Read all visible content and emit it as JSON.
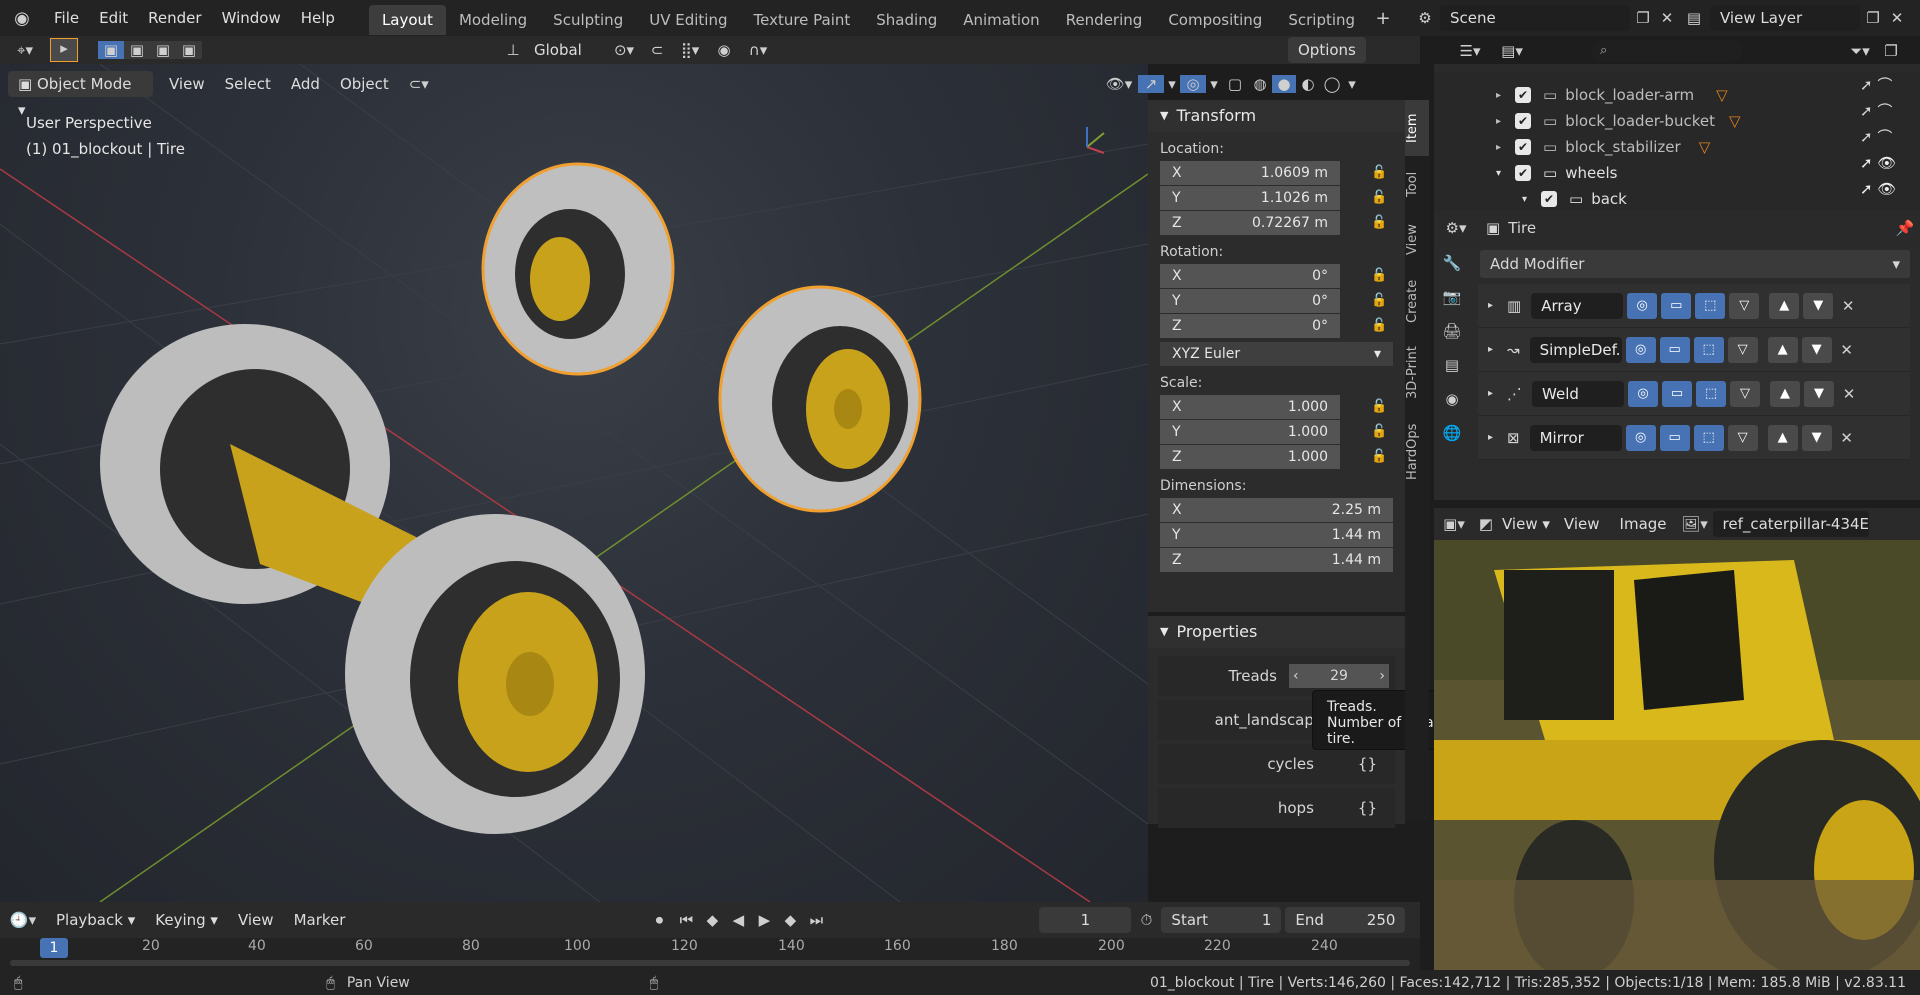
{
  "menu": [
    "File",
    "Edit",
    "Render",
    "Window",
    "Help"
  ],
  "workspaces": [
    {
      "label": "Layout",
      "active": true
    },
    {
      "label": "Modeling"
    },
    {
      "label": "Sculpting"
    },
    {
      "label": "UV Editing"
    },
    {
      "label": "Texture Paint"
    },
    {
      "label": "Shading"
    },
    {
      "label": "Animation"
    },
    {
      "label": "Rendering"
    },
    {
      "label": "Compositing"
    },
    {
      "label": "Scripting"
    }
  ],
  "scene": {
    "label": "Scene",
    "view_layer": "View Layer"
  },
  "toolbar": {
    "orientation": "Global",
    "options": "Options"
  },
  "viewport_header": {
    "mode": "Object Mode",
    "view": "View",
    "select": "Select",
    "add": "Add",
    "object": "Object"
  },
  "viewport": {
    "perspective": "User Perspective",
    "object_info": "(1) 01_blockout | Tire"
  },
  "npanel": {
    "transform_title": "Transform",
    "location_label": "Location:",
    "location": {
      "x": "1.0609 m",
      "y": "1.1026 m",
      "z": "0.72267 m"
    },
    "rotation_label": "Rotation:",
    "rotation": {
      "x": "0°",
      "y": "0°",
      "z": "0°"
    },
    "rotation_mode": "XYZ Euler",
    "scale_label": "Scale:",
    "scale": {
      "x": "1.000",
      "y": "1.000",
      "z": "1.000"
    },
    "dimensions_label": "Dimensions:",
    "dimensions": {
      "x": "2.25 m",
      "y": "1.44 m",
      "z": "1.44 m"
    },
    "properties_title": "Properties",
    "treads_label": "Treads",
    "treads_value": "29",
    "prop_rows": [
      "ant_landscap",
      "cycles",
      "hops"
    ],
    "prop_value": "{}",
    "axis": {
      "x": "X",
      "y": "Y",
      "z": "Z"
    }
  },
  "tooltip": {
    "title": "Treads.",
    "desc": "Number of treads on tire."
  },
  "vtabs": [
    "Item",
    "Tool",
    "View",
    "Create",
    "3D-Print",
    "HardOps"
  ],
  "outliner": {
    "rows": [
      {
        "label": "block_loader-arm",
        "indent": 0
      },
      {
        "label": "block_loader-bucket",
        "indent": 0
      },
      {
        "label": "block_stabilizer",
        "indent": 0
      },
      {
        "label": "wheels",
        "indent": 0
      },
      {
        "label": "back",
        "indent": 1
      }
    ]
  },
  "properties": {
    "object_name": "Tire",
    "add_modifier": "Add Modifier",
    "modifiers": [
      "Array",
      "SimpleDef...",
      "Weld",
      "Mirror"
    ]
  },
  "image_editor": {
    "view_menu": "View",
    "view": "View",
    "image": "Image",
    "image_name": "ref_caterpillar-434E..."
  },
  "timeline": {
    "playback": "Playback",
    "keying": "Keying",
    "view": "View",
    "marker": "Marker",
    "current_frame": "1",
    "start_label": "Start",
    "start": "1",
    "end_label": "End",
    "end": "250",
    "ticks": [
      "1",
      "20",
      "40",
      "60",
      "80",
      "100",
      "120",
      "140",
      "160",
      "180",
      "200",
      "220",
      "240"
    ]
  },
  "statusbar": {
    "pan": "Pan View",
    "info": "01_blockout | Tire | Verts:146,260 | Faces:142,712 | Tris:285,352 | Objects:1/18 | Mem: 185.8 MiB | v2.83.11"
  },
  "colors": {
    "accent": "#4772b3",
    "selection": "#f0a030",
    "yellow_part": "#c9a21b",
    "tire": "#c8c8c8"
  }
}
